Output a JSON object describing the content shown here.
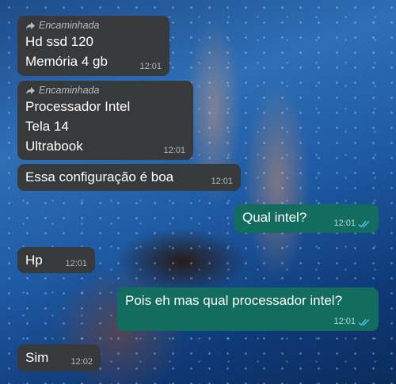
{
  "forwarded_label": "Encaminhada",
  "messages": [
    {
      "direction": "incoming",
      "forwarded": true,
      "lines": [
        "Hd ssd 120",
        "Memória 4 gb"
      ],
      "time": "12:01"
    },
    {
      "direction": "incoming",
      "forwarded": true,
      "lines": [
        "Processador Intel",
        "Tela 14",
        "Ultrabook"
      ],
      "time": "12:01"
    },
    {
      "direction": "incoming",
      "forwarded": false,
      "lines": [
        "Essa configuração é boa"
      ],
      "time": "12:01"
    },
    {
      "direction": "outgoing",
      "forwarded": false,
      "lines": [
        "Qual intel?"
      ],
      "time": "12:01",
      "status": "read"
    },
    {
      "direction": "incoming",
      "forwarded": false,
      "lines": [
        "Hp"
      ],
      "time": "12:01"
    },
    {
      "direction": "outgoing",
      "forwarded": false,
      "lines": [
        "Pois eh mas qual processador intel?"
      ],
      "time": "12:01",
      "status": "read"
    },
    {
      "direction": "incoming",
      "forwarded": false,
      "lines": [
        "Sim"
      ],
      "time": "12:02"
    }
  ],
  "icons": {
    "forward": "forward-arrow-icon",
    "read": "double-check-icon"
  },
  "colors": {
    "incoming": "#38393b",
    "outgoing": "#126d5f",
    "read_ticks": "#53bdeb"
  }
}
